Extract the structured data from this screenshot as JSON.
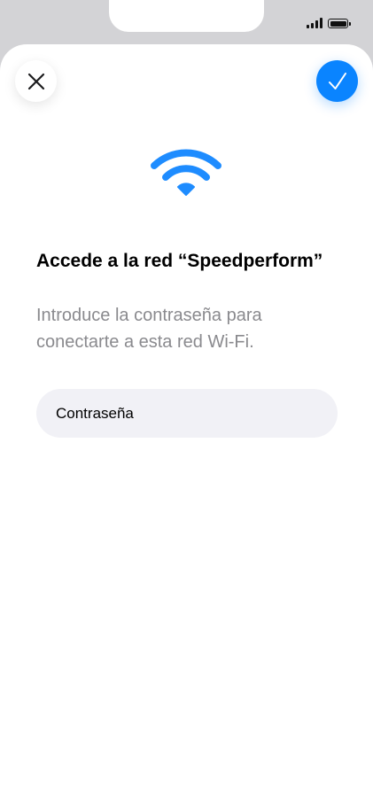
{
  "status_bar": {
    "signal_icon": "cellular-signal-icon",
    "battery_icon": "battery-icon"
  },
  "header": {
    "close_icon": "close-icon",
    "confirm_icon": "checkmark-icon",
    "confirm_color": "#0a84ff"
  },
  "network": {
    "icon": "wifi-icon",
    "icon_color": "#1e8cff",
    "title": "Accede a la red “Speedperform”",
    "subtitle": "Introduce la contraseña para conectarte a esta red Wi-Fi."
  },
  "password": {
    "placeholder": "Contraseña",
    "value": ""
  }
}
